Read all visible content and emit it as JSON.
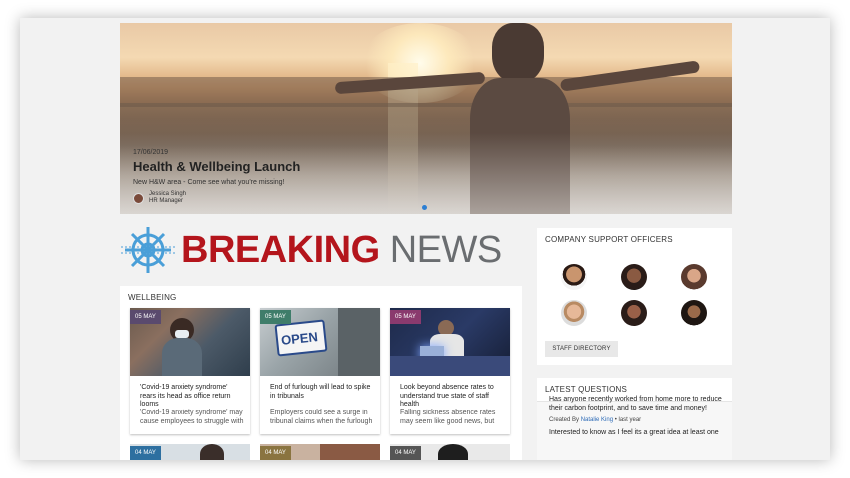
{
  "hero": {
    "date": "17/06/2019",
    "title": "Health & Wellbeing Launch",
    "subtitle": "New H&W area - Come see what you're missing!",
    "author_name": "Jessica Singh",
    "author_role": "HR Manager"
  },
  "breaking_news": {
    "word1": "BREAKING",
    "word2": "NEWS",
    "colors": {
      "red": "#b4151c",
      "grey": "#6a6d70",
      "icon": "#4a9fd8"
    },
    "icon": "ships-wheel-icon"
  },
  "wellbeing": {
    "title": "WELLBEING",
    "cards": [
      {
        "badge": "05 MAY",
        "badge_color": "#5a4a6e",
        "title": "'Covid-19 anxiety syndrome' rears its head as office return looms",
        "excerpt": "'Covid-19 anxiety syndrome' may cause employees to struggle with"
      },
      {
        "badge": "05 MAY",
        "badge_color": "#3f7d6a",
        "title": "End of furlough will lead to spike in tribunals",
        "excerpt": "Employers could see a surge in tribunal claims when the furlough scheme ends in September,"
      },
      {
        "badge": "05 MAY",
        "badge_color": "#8a3a6e",
        "title": "Look beyond absence rates to understand true state of staff health",
        "excerpt": "Falling sickness absence rates may seem like good news, but"
      }
    ],
    "second_row": [
      {
        "badge": "04 MAY",
        "badge_color": "#2d6fa0"
      },
      {
        "badge": "04 MAY",
        "badge_color": "#8a7440"
      },
      {
        "badge": "04 MAY",
        "badge_color": "#555555"
      }
    ]
  },
  "support": {
    "title": "COMPANY SUPPORT OFFICERS",
    "button": "STAFF DIRECTORY"
  },
  "questions": {
    "title": "LATEST QUESTIONS",
    "question": "Has anyone recently worked from home more to reduce their carbon footprint, and to save time and money!",
    "created_by": "Created By",
    "author": "Natalie King",
    "when": "• last year",
    "body": "Interested to know as I feel its a great idea at least one"
  }
}
